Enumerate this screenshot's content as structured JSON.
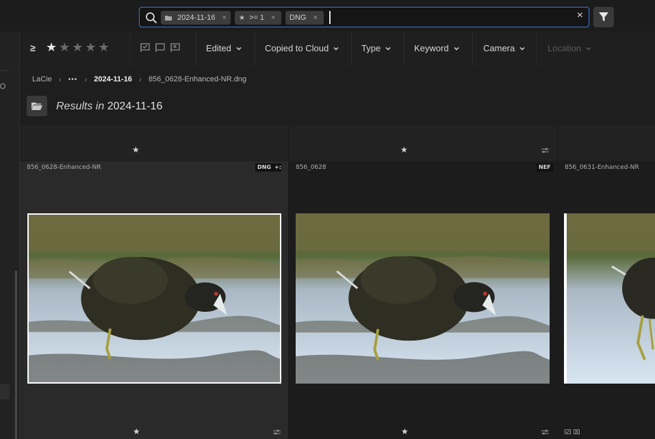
{
  "search": {
    "chips": [
      {
        "icon": "folder-icon",
        "label": "2024-11-16"
      },
      {
        "icon": "star-icon",
        "label": ">= 1"
      },
      {
        "icon": "",
        "label": "DNG"
      }
    ],
    "chip_close": "×",
    "clear": "×"
  },
  "toolbar": {
    "rating_operator": "≥",
    "rating_value": 1,
    "rating_max": 5,
    "filters": [
      {
        "label": "Edited",
        "enabled": true
      },
      {
        "label": "Copied to Cloud",
        "enabled": true
      },
      {
        "label": "Type",
        "enabled": true
      },
      {
        "label": "Keyword",
        "enabled": true
      },
      {
        "label": "Camera",
        "enabled": true
      },
      {
        "label": "Location",
        "enabled": false
      }
    ]
  },
  "breadcrumb": {
    "root": "LaCie",
    "ellipsis": "•••",
    "folder": "2024-11-16",
    "file": "856_0628-Enhanced-NR.dng"
  },
  "results": {
    "prefix": "Results in",
    "folder": "2024-11-16"
  },
  "top_row": {
    "star": "★"
  },
  "photos": [
    {
      "name": "856_0628-Enhanced-NR",
      "type": "DNG",
      "star": "★",
      "selected": true
    },
    {
      "name": "856_0628",
      "type": "NEF",
      "star": "★",
      "selected": false
    },
    {
      "name": "856_0631-Enhanced-NR",
      "type": "",
      "star": "",
      "selected": false
    }
  ],
  "colors": {
    "accent": "#3d7ad6",
    "selection": "#ffffff"
  }
}
